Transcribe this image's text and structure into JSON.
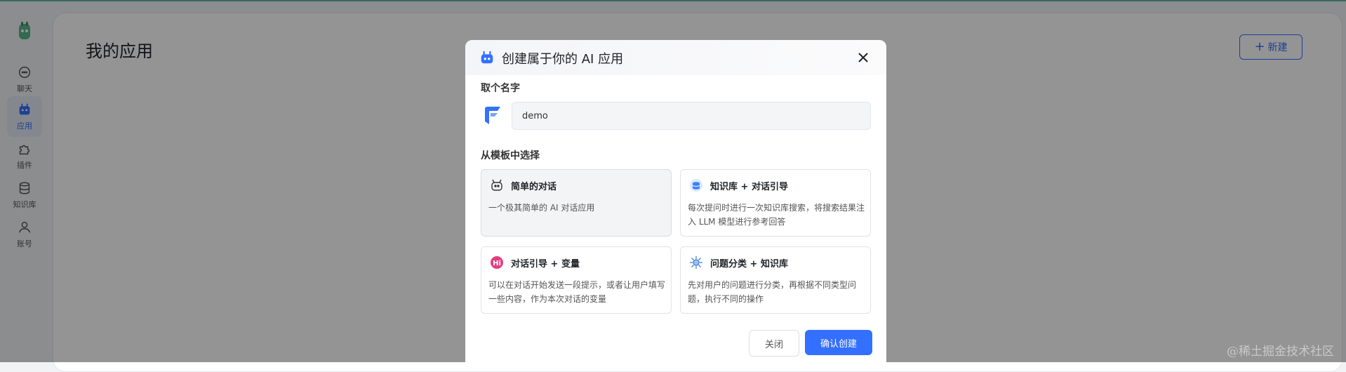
{
  "sidebar": {
    "items": [
      {
        "label": "聊天",
        "icon": "chat-bubble-icon"
      },
      {
        "label": "应用",
        "icon": "robot-icon",
        "active": true
      },
      {
        "label": "插件",
        "icon": "puzzle-icon"
      },
      {
        "label": "知识库",
        "icon": "database-icon"
      },
      {
        "label": "账号",
        "icon": "user-icon"
      }
    ]
  },
  "main": {
    "title": "我的应用",
    "new_button": "新建"
  },
  "modal": {
    "title": "创建属于你的 AI 应用",
    "name_label": "取个名字",
    "name_value": "demo",
    "template_label": "从模板中选择",
    "templates": [
      {
        "title": "简单的对话",
        "desc": "一个极其简单的 AI 对话应用",
        "icon": "simple-chat-icon"
      },
      {
        "title": "知识库 + 对话引导",
        "desc": "每次提问时进行一次知识库搜索，将搜索结果注入 LLM 模型进行参考回答",
        "icon": "knowledge-base-icon"
      },
      {
        "title": "对话引导 + 变量",
        "desc": "可以在对话开始发送一段提示，或者让用户填写一些内容，作为本次对话的变量",
        "icon": "hi-badge-icon"
      },
      {
        "title": "问题分类 + 知识库",
        "desc": "先对用户的问题进行分类，再根据不同类型问题，执行不同的操作",
        "icon": "classify-icon"
      }
    ],
    "cancel_label": "关闭",
    "confirm_label": "确认创建"
  },
  "watermark": "@稀土掘金技术社区",
  "colors": {
    "accent": "#3370ff",
    "overlay": "rgba(0,0,0,0.42)"
  }
}
